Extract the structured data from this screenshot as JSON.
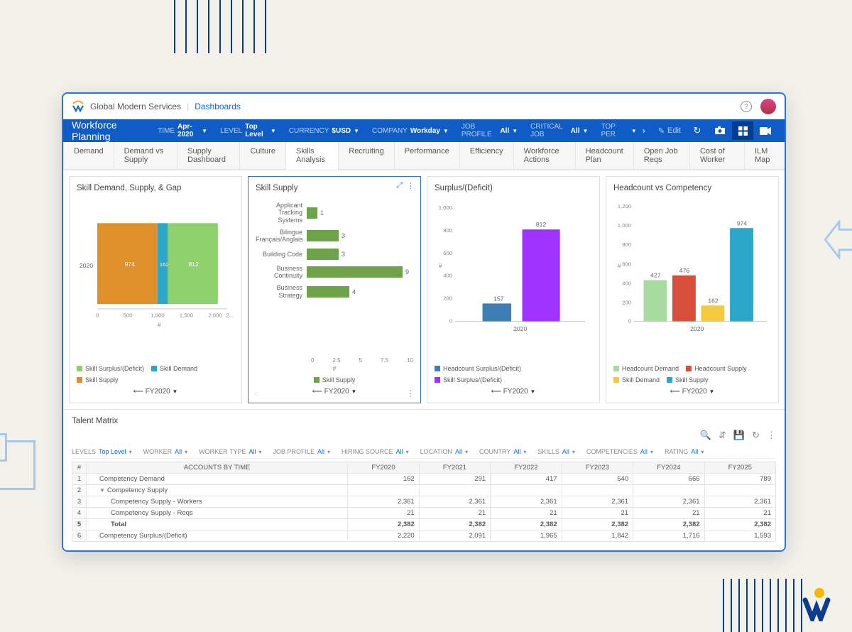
{
  "topbar": {
    "company": "Global Modern Services",
    "link": "Dashboards"
  },
  "page_title": "Workforce Planning",
  "filters": [
    {
      "label": "TIME",
      "value": "Apr-2020"
    },
    {
      "label": "LEVEL",
      "value": "Top Level"
    },
    {
      "label": "CURRENCY",
      "value": "$USD"
    },
    {
      "label": "COMPANY",
      "value": "Workday"
    },
    {
      "label": "JOB PROFILE",
      "value": "All"
    },
    {
      "label": "CRITICAL JOB",
      "value": "All"
    },
    {
      "label": "TOP PER",
      "value": ""
    }
  ],
  "edit_label": "Edit",
  "tabs": [
    "Demand",
    "Demand vs Supply",
    "Supply Dashboard",
    "Culture",
    "Skills Analysis",
    "Recruiting",
    "Performance",
    "Efficiency",
    "Workforce Actions",
    "Headcount Plan",
    "Open Job Reqs",
    "Cost of Worker",
    "ILM Map"
  ],
  "active_tab": "Skills Analysis",
  "cards": {
    "c1": {
      "title": "Skill Demand, Supply, & Gap",
      "foot": "FY2020",
      "legend": [
        {
          "c": "#8ed06b",
          "t": "Skill Surplus/(Deficit)"
        },
        {
          "c": "#2aa7c9",
          "t": "Skill Demand"
        },
        {
          "c": "#e0902a",
          "t": "Skill Supply"
        }
      ]
    },
    "c2": {
      "title": "Skill Supply",
      "foot": "FY2020",
      "legend": [
        {
          "c": "#6fa34a",
          "t": "Skill Supply"
        }
      ]
    },
    "c3": {
      "title": "Surplus/(Deficit)",
      "foot": "FY2020",
      "legend": [
        {
          "c": "#3b7fb3",
          "t": "Headcount Surplus/(Deficit)"
        },
        {
          "c": "#a033ff",
          "t": "Skill Surplus/(Deficit)"
        }
      ]
    },
    "c4": {
      "title": "Headcount vs Competency",
      "foot": "FY2020",
      "legend": [
        {
          "c": "#a8dba0",
          "t": "Headcount Demand"
        },
        {
          "c": "#d94e3a",
          "t": "Headcount Supply"
        },
        {
          "c": "#f5c93f",
          "t": "Skill Demand"
        },
        {
          "c": "#2aa7c9",
          "t": "Skill Supply"
        }
      ]
    }
  },
  "matrix": {
    "title": "Talent Matrix",
    "filters": [
      {
        "l": "LEVELS",
        "v": "Top Level"
      },
      {
        "l": "WORKER",
        "v": "All"
      },
      {
        "l": "WORKER TYPE",
        "v": "All"
      },
      {
        "l": "JOB PROFILE",
        "v": "All"
      },
      {
        "l": "HIRING SOURCE",
        "v": "All"
      },
      {
        "l": "LOCATION",
        "v": "All"
      },
      {
        "l": "COUNTRY",
        "v": "All"
      },
      {
        "l": "SKILLS",
        "v": "All"
      },
      {
        "l": "COMPETENCIES",
        "v": "All"
      },
      {
        "l": "RATING",
        "v": "All"
      }
    ],
    "header": [
      "#",
      "ACCOUNTS BY TIME",
      "FY2020",
      "FY2021",
      "FY2022",
      "FY2023",
      "FY2024",
      "FY2025"
    ],
    "rows": [
      {
        "i": 1,
        "lbl": "Competency Demand",
        "ind": 0,
        "v": [
          162,
          291,
          417,
          540,
          666,
          789
        ]
      },
      {
        "i": 2,
        "lbl": "Competency Supply",
        "ind": 0,
        "tree": true,
        "v": [
          "",
          "",
          "",
          "",
          "",
          ""
        ]
      },
      {
        "i": 3,
        "lbl": "Competency Supply - Workers",
        "ind": 1,
        "v": [
          "2,361",
          "2,361",
          "2,361",
          "2,361",
          "2,361",
          "2,361"
        ]
      },
      {
        "i": 4,
        "lbl": "Competency Supply - Reqs",
        "ind": 1,
        "v": [
          21,
          21,
          21,
          21,
          21,
          21
        ]
      },
      {
        "i": 5,
        "lbl": "Total",
        "ind": 1,
        "total": true,
        "v": [
          "2,382",
          "2,382",
          "2,382",
          "2,382",
          "2,382",
          "2,382"
        ]
      },
      {
        "i": 6,
        "lbl": "Competency Surplus/(Deficit)",
        "ind": 0,
        "v": [
          "2,220",
          "2,091",
          "1,965",
          "1,842",
          "1,716",
          "1,593"
        ]
      }
    ]
  },
  "chart_data": [
    {
      "id": "c1",
      "type": "bar",
      "orientation": "horizontal-stacked",
      "title": "Skill Demand, Supply, & Gap",
      "categories": [
        "2020"
      ],
      "xlabel": "#",
      "xticks": [
        0,
        500,
        1000,
        1500,
        2000
      ],
      "series": [
        {
          "name": "Skill Supply",
          "values": [
            974
          ],
          "color": "#e0902a"
        },
        {
          "name": "Skill Demand",
          "values": [
            162
          ],
          "color": "#2aa7c9"
        },
        {
          "name": "Skill Surplus/(Deficit)",
          "values": [
            812
          ],
          "color": "#8ed06b"
        }
      ]
    },
    {
      "id": "c2",
      "type": "bar",
      "orientation": "horizontal",
      "title": "Skill Supply",
      "categories": [
        "Applicant Tracking Systems",
        "Bilingue Français/Anglais",
        "Building Code",
        "Business Continuity",
        "Business Strategy"
      ],
      "values": [
        1,
        3,
        3,
        9,
        4
      ],
      "xlabel": "#",
      "xlim": [
        0,
        10
      ],
      "xticks": [
        0,
        2.5,
        5,
        7.5,
        10
      ],
      "color": "#6fa34a"
    },
    {
      "id": "c3",
      "type": "bar",
      "title": "Surplus/(Deficit)",
      "categories": [
        "2020"
      ],
      "ylabel": "#",
      "ylim": [
        0,
        1000
      ],
      "yticks": [
        0,
        200,
        400,
        600,
        800,
        1000
      ],
      "series": [
        {
          "name": "Headcount Surplus/(Deficit)",
          "values": [
            157
          ],
          "color": "#3b7fb3"
        },
        {
          "name": "Skill Surplus/(Deficit)",
          "values": [
            812
          ],
          "color": "#a033ff"
        }
      ]
    },
    {
      "id": "c4",
      "type": "bar",
      "title": "Headcount vs Competency",
      "categories": [
        "2020"
      ],
      "ylabel": "#",
      "ylim": [
        0,
        1200
      ],
      "yticks": [
        0,
        200,
        400,
        600,
        800,
        1000,
        1200
      ],
      "series": [
        {
          "name": "Headcount Demand",
          "values": [
            427
          ],
          "color": "#a8dba0"
        },
        {
          "name": "Headcount Supply",
          "values": [
            476
          ],
          "color": "#d94e3a"
        },
        {
          "name": "Skill Demand",
          "values": [
            162
          ],
          "color": "#f5c93f"
        },
        {
          "name": "Skill Supply",
          "values": [
            974
          ],
          "color": "#2aa7c9"
        }
      ]
    }
  ]
}
